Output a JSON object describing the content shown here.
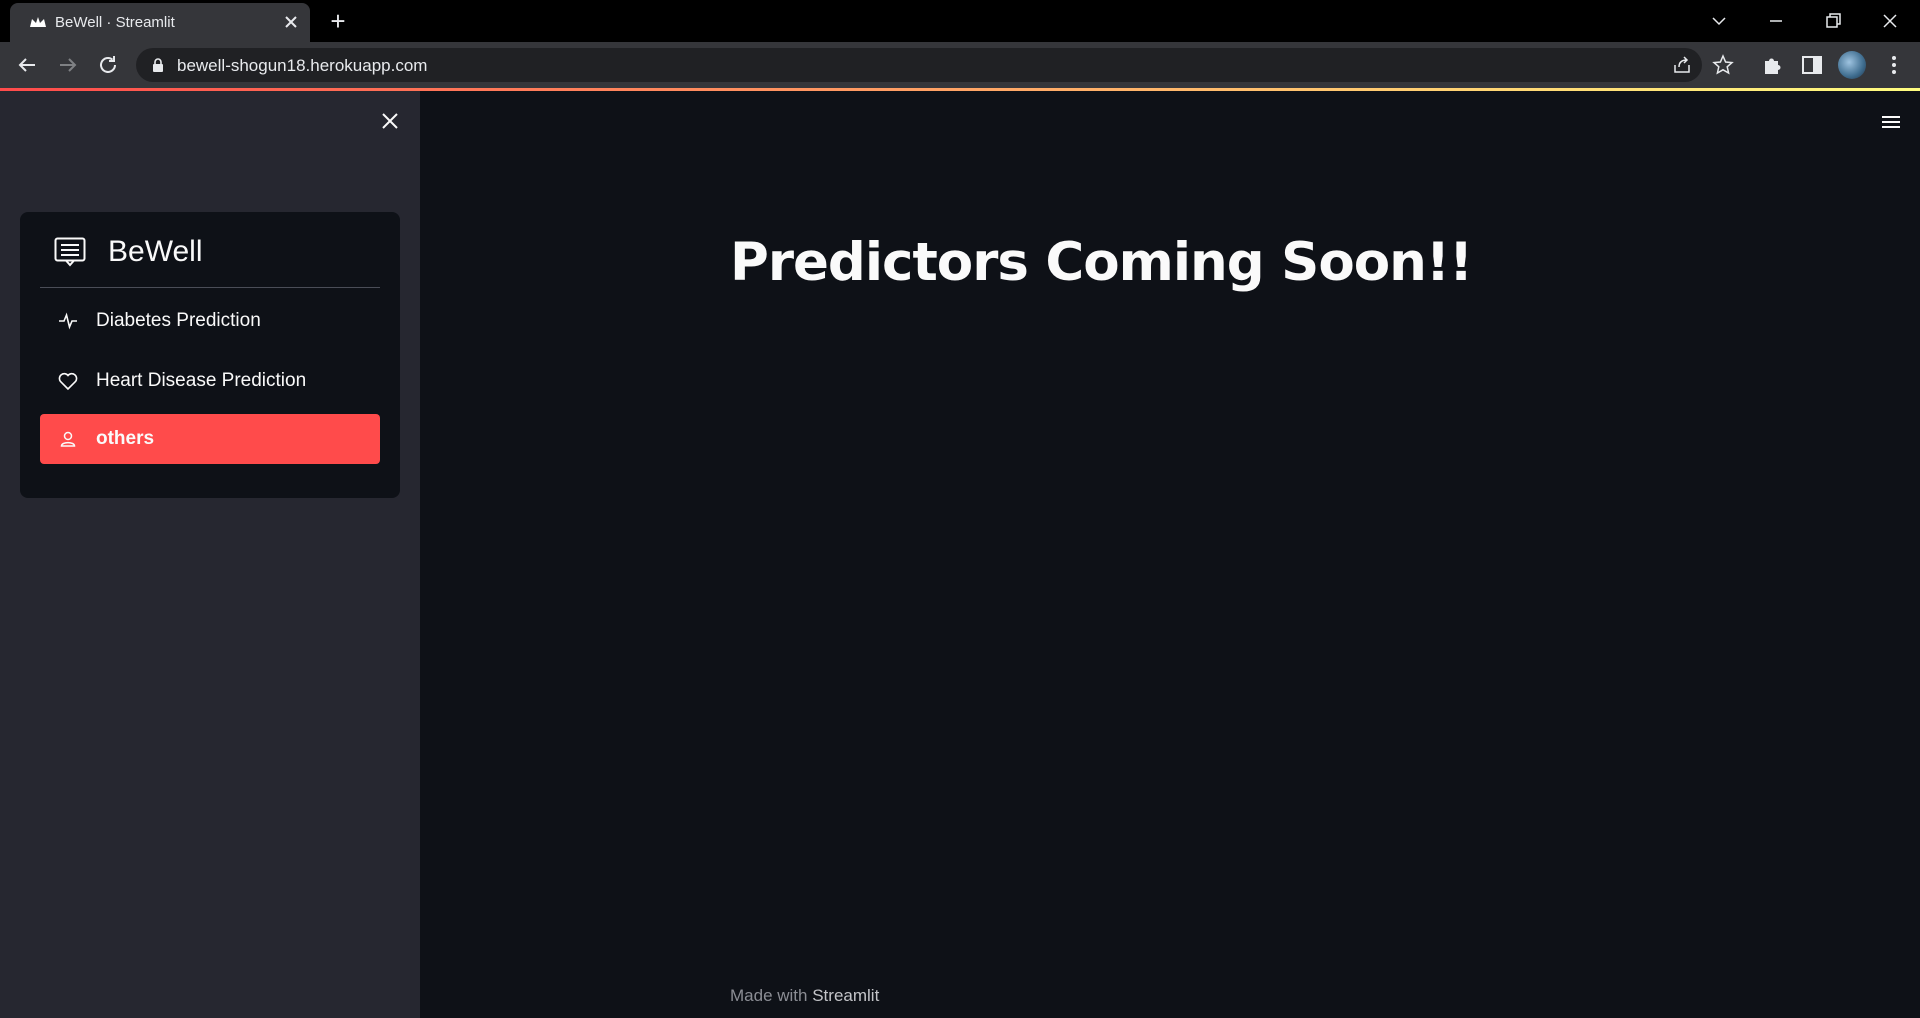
{
  "browser": {
    "tab_title": "BeWell · Streamlit",
    "new_tab_symbol": "+",
    "url": "bewell-shogun18.herokuapp.com",
    "icons": [
      "streamlit-favicon",
      "close-icon",
      "plus-icon",
      "chevron-down-icon",
      "minimize-icon",
      "restore-icon",
      "close-window-icon",
      "back-icon",
      "forward-icon",
      "reload-icon",
      "lock-icon",
      "share-icon",
      "star-icon",
      "puzzle-icon",
      "side-panel-icon",
      "avatar",
      "kebab-icon"
    ]
  },
  "sidebar": {
    "menu": {
      "title": "BeWell",
      "items": [
        {
          "label": "Diabetes Prediction",
          "icon": "activity-icon",
          "active": false
        },
        {
          "label": "Heart Disease Prediction",
          "icon": "heart-icon",
          "active": false
        },
        {
          "label": "others",
          "icon": "person-icon",
          "active": true
        }
      ]
    }
  },
  "main": {
    "title": "Predictors Coming Soon!!",
    "footer_prefix": "Made with",
    "footer_brand": "Streamlit"
  },
  "colors": {
    "accent": "#ff4b4b",
    "sidebar_bg": "#262730",
    "main_bg": "#0e1117"
  }
}
